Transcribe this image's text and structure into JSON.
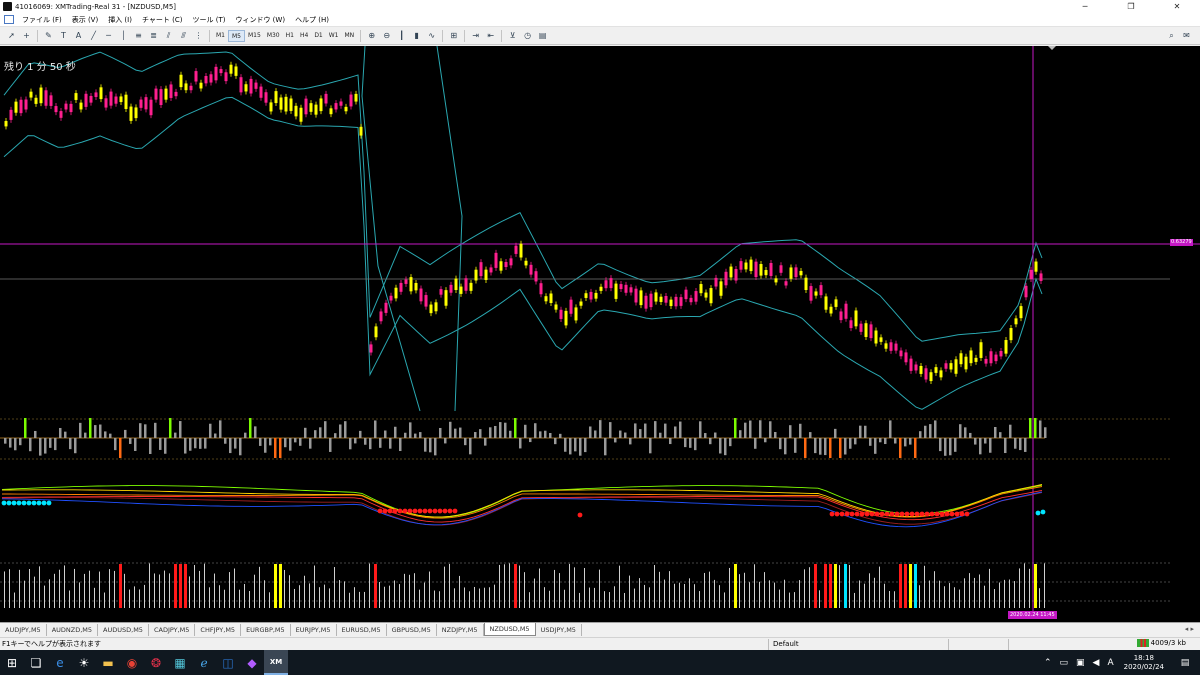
{
  "window": {
    "title": "41016069: XMTrading-Real 31 - [NZDUSD,M5]"
  },
  "window_controls": {
    "minimize": "─",
    "restore": "❐",
    "close": "✕"
  },
  "menu": [
    "ファイル (F)",
    "表示 (V)",
    "挿入 (I)",
    "チャート (C)",
    "ツール (T)",
    "ウィンドウ (W)",
    "ヘルプ (H)"
  ],
  "toolbar": {
    "timeframes": [
      "M1",
      "M5",
      "M15",
      "M30",
      "H1",
      "H4",
      "D1",
      "W1",
      "MN"
    ],
    "active_timeframe": "M5"
  },
  "chart": {
    "symbol": "NZDUSD",
    "timeframe": "M5",
    "countdown": "残り 1 分 50 秒",
    "price_tag": "0.63279",
    "time_tag": "2020.02.24 11:45",
    "colors": {
      "background": "#000000",
      "bull_candle": "#ffff00",
      "bear_candle": "#ff1f8f",
      "bands": "#2aa7b0",
      "crosshair": "#c418c4",
      "hist_up": "#7cfc00",
      "hist_down": "#ff6a13",
      "hist_neutral": "#9a9a9a"
    }
  },
  "tabs": [
    "AUDJPY,M5",
    "AUDNZD,M5",
    "AUDUSD,M5",
    "CADJPY,M5",
    "CHFJPY,M5",
    "EURGBP,M5",
    "EURJPY,M5",
    "EURUSD,M5",
    "GBPUSD,M5",
    "NZDJPY,M5",
    "NZDUSD,M5",
    "USDJPY,M5"
  ],
  "active_tab": "NZDUSD,M5",
  "status": {
    "help": "F1キーでヘルプが表示されます",
    "profile": "Default",
    "traffic": "4009/3 kb"
  },
  "taskbar": {
    "time": "18:18",
    "date": "2020/02/24",
    "ime": "A"
  }
}
